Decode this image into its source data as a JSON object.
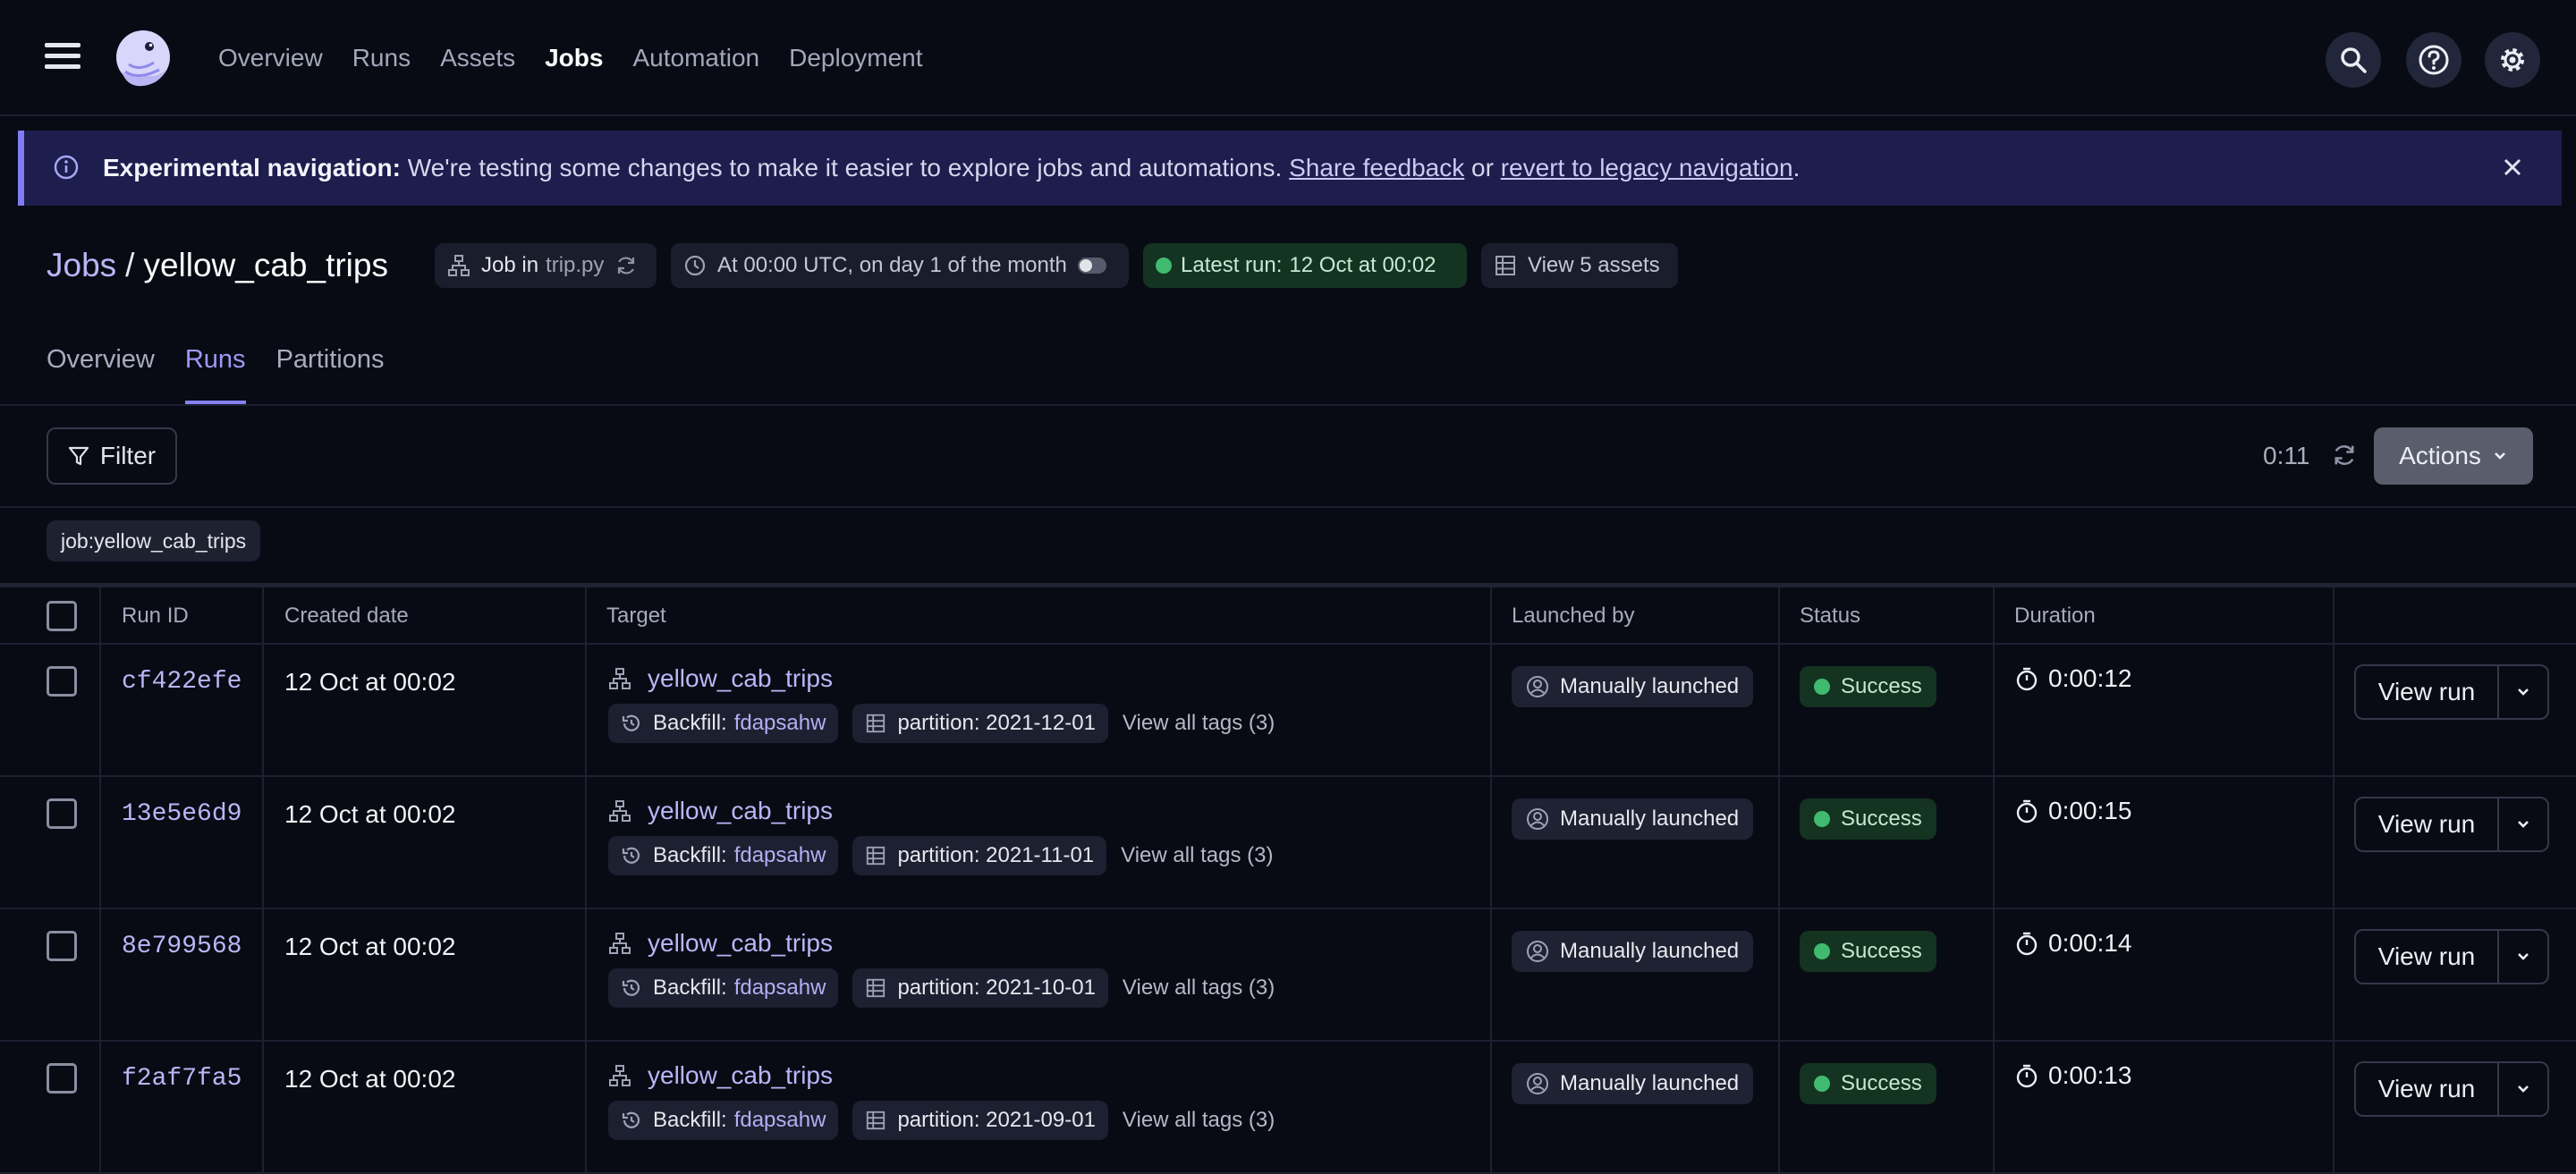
{
  "nav": {
    "links": [
      "Overview",
      "Runs",
      "Assets",
      "Jobs",
      "Automation",
      "Deployment"
    ],
    "active": "Jobs"
  },
  "banner": {
    "title": "Experimental navigation:",
    "text": " We're testing some changes to make it easier to explore jobs and automations. ",
    "link1": "Share feedback",
    "middle": " or ",
    "link2": "revert to legacy navigation",
    "end": "."
  },
  "header": {
    "breadcrumb_root": "Jobs",
    "separator": "/",
    "job_name": "yellow_cab_trips",
    "job_in_label": "Job in",
    "job_file": "trip.py",
    "schedule": "At 00:00 UTC, on day 1 of the month",
    "latest_run_label": "Latest run:",
    "latest_run_value": "12 Oct at 00:02",
    "view_assets": "View 5 assets"
  },
  "tabs": [
    "Overview",
    "Runs",
    "Partitions"
  ],
  "active_tab": "Runs",
  "toolbar": {
    "filter_label": "Filter",
    "refresh_timer": "0:11",
    "actions_label": "Actions",
    "active_filter_tag": "job:yellow_cab_trips"
  },
  "table": {
    "headers": [
      "Run ID",
      "Created date",
      "Target",
      "Launched by",
      "Status",
      "Duration"
    ],
    "rows": [
      {
        "run_id": "cf422efe",
        "created": "12 Oct at 00:02",
        "target": "yellow_cab_trips",
        "backfill_label": "Backfill:",
        "backfill_id": "fdapsahw",
        "partition": "partition: 2021-12-01",
        "all_tags": "View all tags (3)",
        "launched_by": "Manually launched",
        "status": "Success",
        "duration": "0:00:12",
        "view": "View run"
      },
      {
        "run_id": "13e5e6d9",
        "created": "12 Oct at 00:02",
        "target": "yellow_cab_trips",
        "backfill_label": "Backfill:",
        "backfill_id": "fdapsahw",
        "partition": "partition: 2021-11-01",
        "all_tags": "View all tags (3)",
        "launched_by": "Manually launched",
        "status": "Success",
        "duration": "0:00:15",
        "view": "View run"
      },
      {
        "run_id": "8e799568",
        "created": "12 Oct at 00:02",
        "target": "yellow_cab_trips",
        "backfill_label": "Backfill:",
        "backfill_id": "fdapsahw",
        "partition": "partition: 2021-10-01",
        "all_tags": "View all tags (3)",
        "launched_by": "Manually launched",
        "status": "Success",
        "duration": "0:00:14",
        "view": "View run"
      },
      {
        "run_id": "f2af7fa5",
        "created": "12 Oct at 00:02",
        "target": "yellow_cab_trips",
        "backfill_label": "Backfill:",
        "backfill_id": "fdapsahw",
        "partition": "partition: 2021-09-01",
        "all_tags": "View all tags (3)",
        "launched_by": "Manually launched",
        "status": "Success",
        "duration": "0:00:13",
        "view": "View run"
      }
    ]
  },
  "colors": {
    "background": "#080b14",
    "accent": "#8581f0",
    "banner_bg": "#1d1d4e",
    "success": "#3fba6f",
    "success_bg": "#143321"
  },
  "icons": [
    "menu-icon",
    "dagster-logo",
    "search-icon",
    "help-icon",
    "settings-icon",
    "info-icon",
    "close-icon",
    "job-graph-icon",
    "refresh-icon",
    "clock-icon",
    "toggle",
    "table-icon",
    "filter-icon",
    "chevron-down-icon",
    "backfill-icon",
    "partition-icon",
    "user-icon",
    "timer-icon"
  ]
}
